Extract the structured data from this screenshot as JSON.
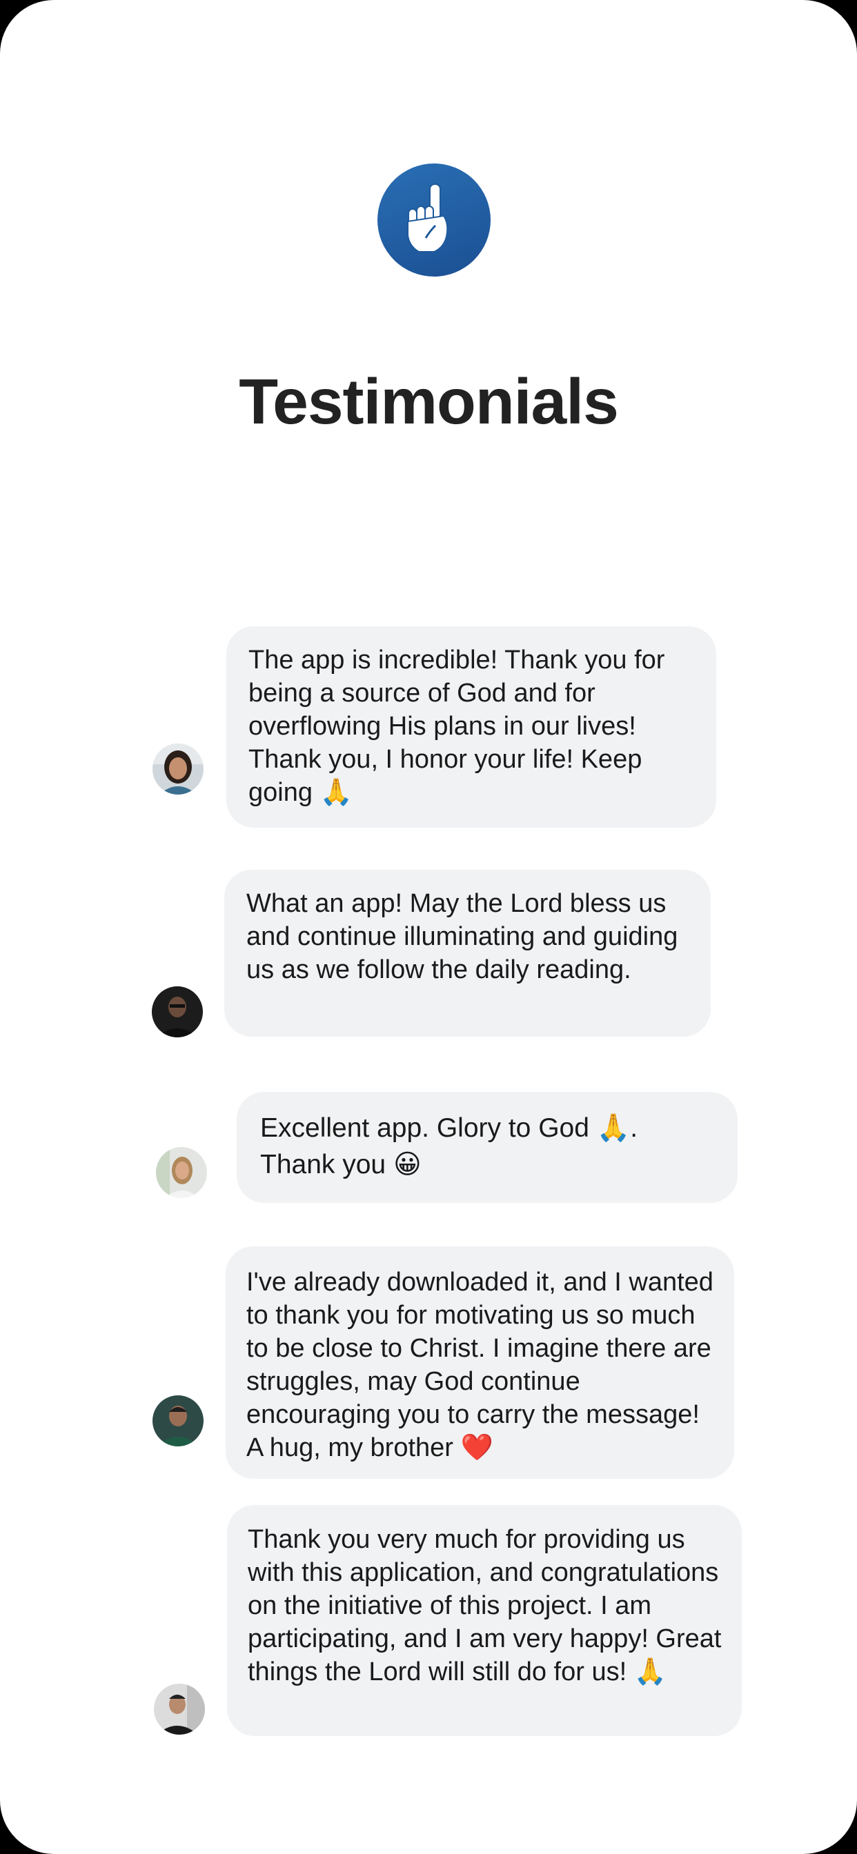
{
  "header": {
    "title": "Testimonials",
    "logo_icon": "pointing-up-hand-icon",
    "logo_color": "#1f5da3"
  },
  "testimonials": [
    {
      "avatar": "avatar-woman-dark-hair",
      "text": "The app is incredible! Thank you for being a source of God and for overflowing His plans in our lives! Thank you, I honor your life! Keep going 🙏"
    },
    {
      "avatar": "avatar-man-dark-shirt",
      "text": "What an app! May the Lord bless us and continue illuminating and guiding us as we follow the daily reading."
    },
    {
      "avatar": "avatar-woman-blonde",
      "text": "Excellent app. Glory to God 🙏. Thank you 😀"
    },
    {
      "avatar": "avatar-man-green-shirt",
      "text": "I've already downloaded it, and I wanted to thank you for motivating us so much to be close to Christ. I imagine there are struggles, may God continue encouraging you to carry the message! A hug, my brother ❤️"
    },
    {
      "avatar": "avatar-man-selfie",
      "text": "Thank you very much for providing us with this application, and congratulations on the initiative of this project. I am participating, and I am very happy! Great things the Lord will still do for us! 🙏"
    }
  ],
  "colors": {
    "bubble_background": "#f1f2f4",
    "title_text": "#222222",
    "bubble_text": "#1a1a1a"
  }
}
